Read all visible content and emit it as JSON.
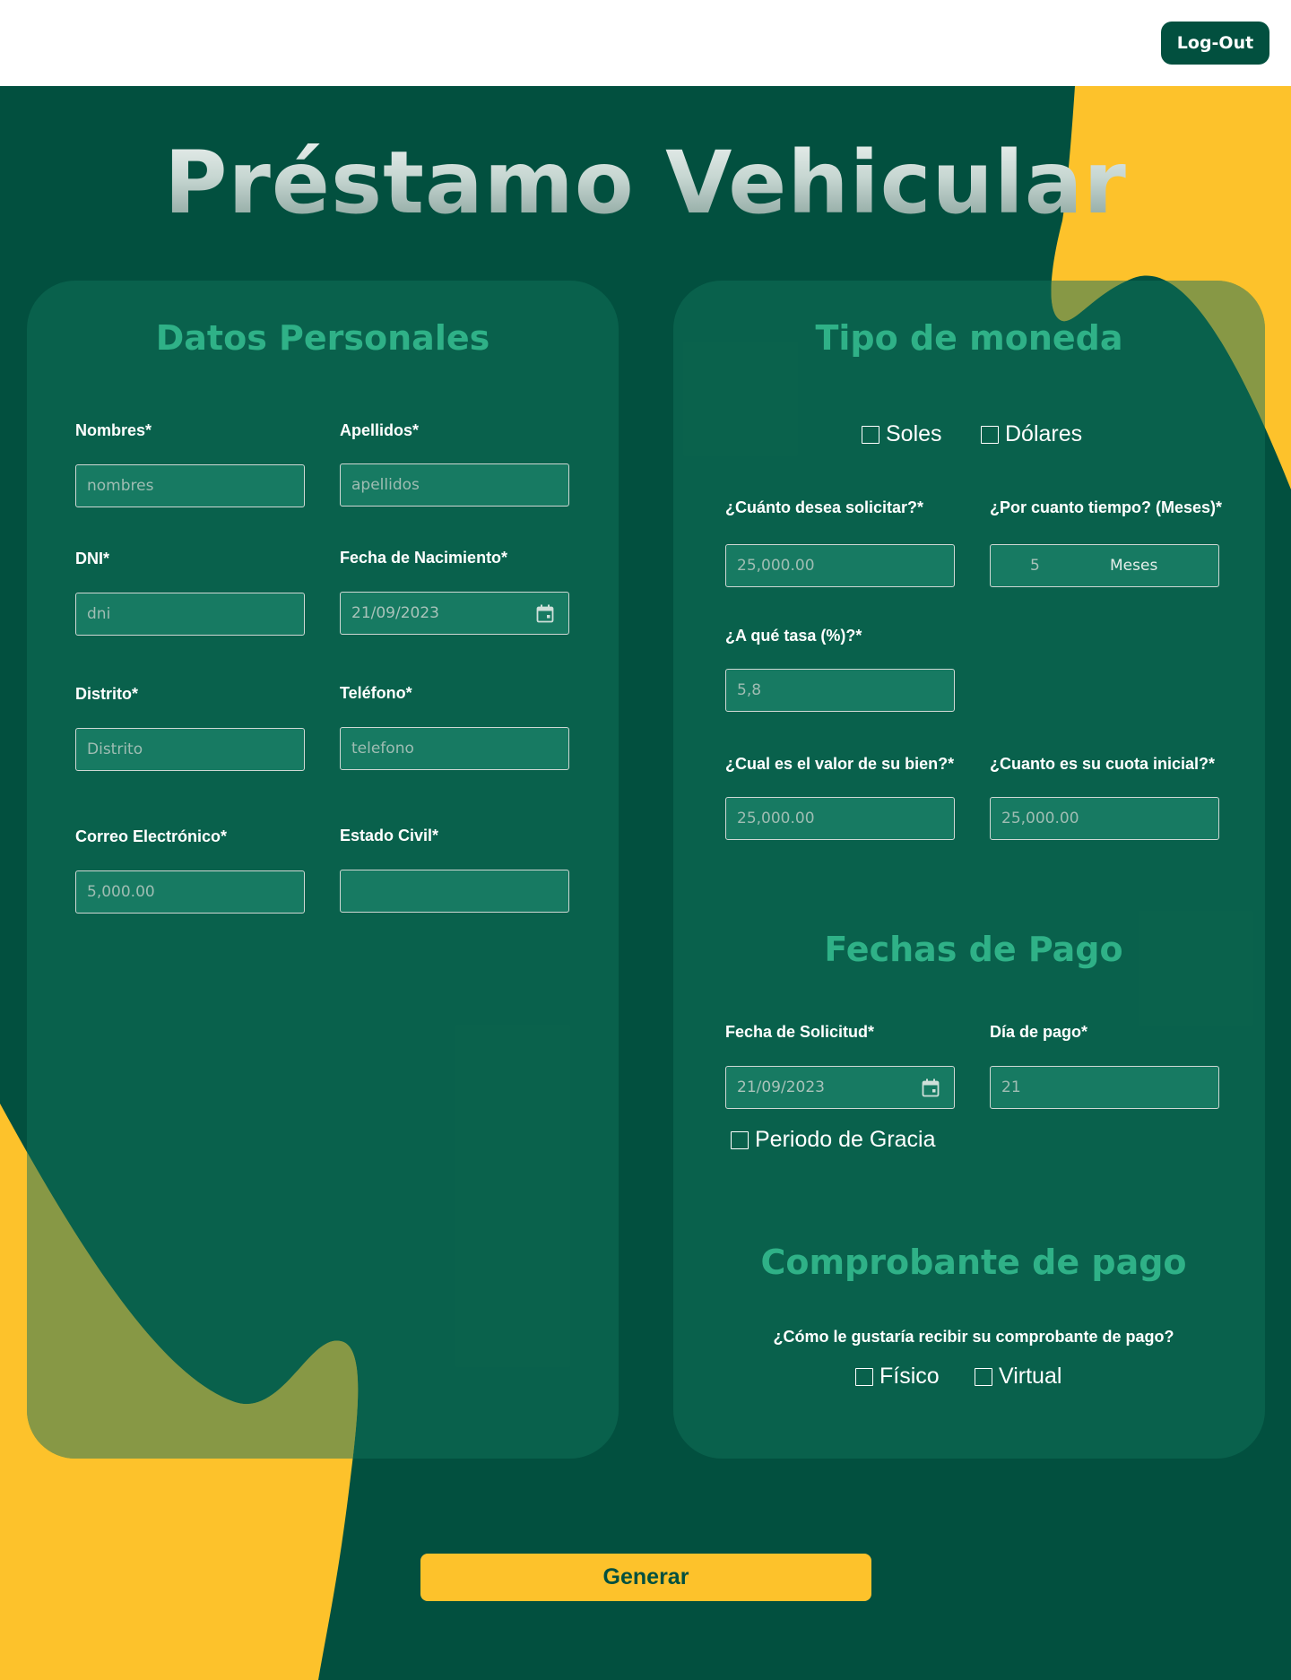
{
  "header": {
    "logout_label": "Log-Out"
  },
  "page": {
    "title": "Préstamo Vehicular"
  },
  "personal": {
    "title": "Datos Personales",
    "nombres": {
      "label": "Nombres*",
      "placeholder": "nombres"
    },
    "apellidos": {
      "label": "Apellidos*",
      "placeholder": "apellidos"
    },
    "dni": {
      "label": "DNI*",
      "placeholder": "dni"
    },
    "fecha_nacimiento": {
      "label": "Fecha de Nacimiento*",
      "value": "21/09/2023",
      "icon": "calendar-icon"
    },
    "distrito": {
      "label": "Distrito*",
      "placeholder": "Distrito"
    },
    "telefono": {
      "label": "Teléfono*",
      "placeholder": "telefono"
    },
    "correo": {
      "label": "Correo Electrónico*",
      "placeholder": "5,000.00"
    },
    "estado_civil": {
      "label": "Estado Civil*",
      "placeholder": ""
    }
  },
  "moneda": {
    "title": "Tipo de moneda",
    "options": [
      "Soles",
      "Dólares"
    ],
    "monto": {
      "label": "¿Cuánto desea solicitar?*",
      "placeholder": "25,000.00"
    },
    "tiempo": {
      "label": "¿Por cuanto tiempo? (Meses)*",
      "value": "5",
      "suffix": "Meses"
    },
    "tasa": {
      "label": "¿A qué tasa (%)?*",
      "placeholder": "5,8"
    },
    "valor_bien": {
      "label": "¿Cual es el valor de su bien?*",
      "placeholder": "25,000.00"
    },
    "cuota_inicial": {
      "label": "¿Cuanto es su cuota inicial?*",
      "placeholder": "25,000.00"
    }
  },
  "pago": {
    "title": "Fechas de Pago",
    "fecha_solicitud": {
      "label": "Fecha de Solicitud*",
      "value": "21/09/2023",
      "icon": "calendar-icon"
    },
    "dia_pago": {
      "label": "Día de pago*",
      "placeholder": "21"
    },
    "gracia_label": "Periodo de Gracia"
  },
  "comprobante": {
    "title": "Comprobante de pago",
    "question": "¿Cómo le gustaría recibir su comprobante de pago?",
    "options": [
      "Físico",
      "Virtual"
    ]
  },
  "actions": {
    "generate_label": "Generar"
  },
  "colors": {
    "background": "#02503f",
    "card": "#0b614d",
    "accent_yellow": "#fdc22b",
    "olive_overlay": "#879845",
    "section_title": "#2fb187",
    "input_bg": "#177a62"
  }
}
